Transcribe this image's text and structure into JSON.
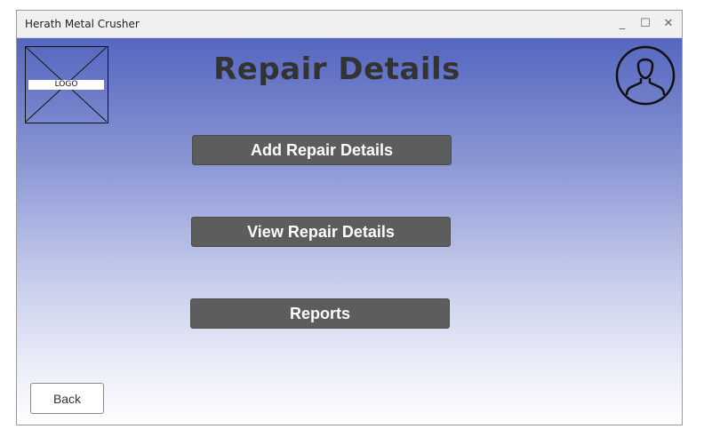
{
  "window": {
    "title": "Herath Metal Crusher",
    "minimize_glyph": "_",
    "maximize_glyph": "☐",
    "close_glyph": "✕"
  },
  "header": {
    "logo_label": "LOGO",
    "page_title": "Repair Details",
    "avatar_icon": "user-profile-icon"
  },
  "main": {
    "buttons": [
      {
        "label": "Add Repair Details"
      },
      {
        "label": "View Repair Details"
      },
      {
        "label": "Reports"
      }
    ]
  },
  "footer": {
    "back_label": "Back"
  },
  "colors": {
    "gradient_top": "#5566bf",
    "gradient_bottom": "#ffffff",
    "button_bg": "#5d5d5d",
    "button_text": "#ffffff",
    "title_text": "#333333"
  }
}
